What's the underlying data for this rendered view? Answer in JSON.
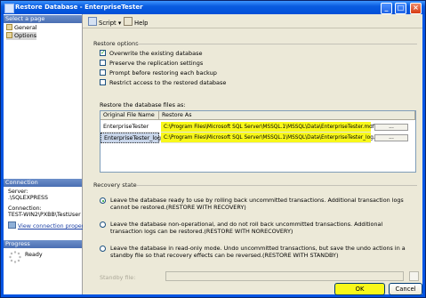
{
  "window": {
    "title": "Restore Database - EnterpriseTester",
    "controls": {
      "minimize": "_",
      "maximize": "□",
      "close": "×"
    }
  },
  "sidebar": {
    "select_page_header": "Select a page",
    "pages": [
      {
        "label": "General",
        "icon": "page-icon"
      },
      {
        "label": "Options",
        "icon": "page-icon"
      }
    ],
    "connection_header": "Connection",
    "server_label": "Server:",
    "server_value": ".\\SQLEXPRESS",
    "connection_label": "Connection:",
    "connection_value": "TEST-WIN2\\PXBB\\TestUser",
    "view_connection_link": "View connection properties",
    "progress_header": "Progress",
    "progress_status": "Ready"
  },
  "toolbar": {
    "script_label": "Script",
    "help_label": "Help"
  },
  "restore_options": {
    "title": "Restore options",
    "checkboxes": [
      {
        "label": "Overwrite the existing database",
        "checked": true
      },
      {
        "label": "Preserve the replication settings",
        "checked": false
      },
      {
        "label": "Prompt before restoring each backup",
        "checked": false
      },
      {
        "label": "Restrict access to the restored database",
        "checked": false
      }
    ],
    "files_label": "Restore the database files as:",
    "grid": {
      "columns": [
        "Original File Name",
        "Restore As"
      ],
      "rows": [
        {
          "original": "EnterpriseTester",
          "restore_as": "C:\\Program Files\\Microsoft SQL Server\\MSSQL.1\\MSSQL\\Data\\EnterpriseTester.mdf",
          "button": "..."
        },
        {
          "original": "EnterpriseTester_log",
          "restore_as": "C:\\Program Files\\Microsoft SQL Server\\MSSQL.1\\MSSQL\\Data\\EnterpriseTester_log.LDF",
          "button": "..."
        }
      ]
    }
  },
  "recovery_state": {
    "title": "Recovery state",
    "options": [
      {
        "text": "Leave the database ready to use by rolling back uncommitted transactions. Additional transaction logs cannot be restored.(RESTORE WITH RECOVERY)",
        "selected": true
      },
      {
        "text": "Leave the database non-operational, and do not roll back uncommitted transactions. Additional transaction logs can be restored.(RESTORE WITH NORECOVERY)",
        "selected": false
      },
      {
        "text": "Leave the database in read-only mode. Undo uncommitted transactions, but save the undo actions in a standby file so that recovery effects can be reversed.(RESTORE WITH STANDBY)",
        "selected": false
      }
    ],
    "standby_label": "Standby file:",
    "standby_value": "",
    "browse_button": ""
  },
  "buttons": {
    "ok": "OK",
    "cancel": "Cancel"
  },
  "colors": {
    "highlight": "#f8f81a",
    "title_bar": "#0054e3"
  }
}
